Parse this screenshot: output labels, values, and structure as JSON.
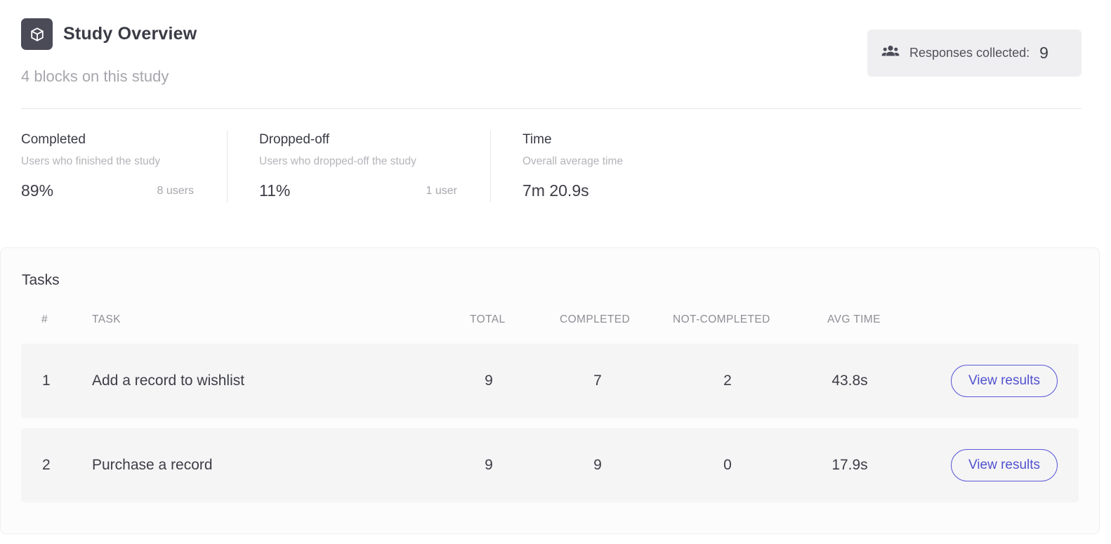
{
  "header": {
    "title": "Study Overview",
    "subtitle": "4 blocks on this study",
    "icon": "cube-icon",
    "responses": {
      "icon": "users-icon",
      "label": "Responses collected:",
      "count": "9"
    }
  },
  "stats": {
    "completed": {
      "title": "Completed",
      "description": "Users who finished the study",
      "value": "89%",
      "users": "8 users"
    },
    "dropped": {
      "title": "Dropped-off",
      "description": "Users who dropped-off the study",
      "value": "11%",
      "users": "1 user"
    },
    "time": {
      "title": "Time",
      "description": "Overall average time",
      "value": "7m 20.9s"
    }
  },
  "tasks": {
    "title": "Tasks",
    "columns": [
      "#",
      "TASK",
      "TOTAL",
      "COMPLETED",
      "NOT-COMPLETED",
      "AVG TIME"
    ],
    "rows": [
      {
        "num": "1",
        "task": "Add a record to wishlist",
        "total": "9",
        "completed": "7",
        "not_completed": "2",
        "avg_time": "43.8s",
        "action": "View results"
      },
      {
        "num": "2",
        "task": "Purchase a record",
        "total": "9",
        "completed": "9",
        "not_completed": "0",
        "avg_time": "17.9s",
        "action": "View results"
      }
    ]
  },
  "colors": {
    "accent": "#5b5bd6",
    "icon_bg": "#4a4b57",
    "row_bg": "#f5f5f6"
  }
}
